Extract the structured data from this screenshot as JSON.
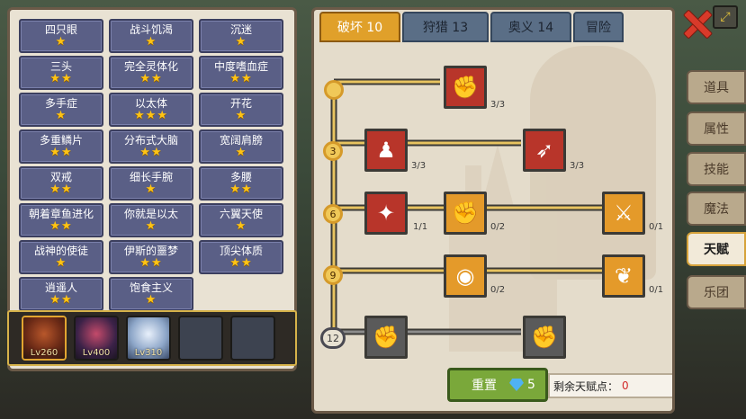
{
  "traits": [
    {
      "name": "四只眼",
      "stars": 1
    },
    {
      "name": "战斗饥渴",
      "stars": 1
    },
    {
      "name": "沉迷",
      "stars": 1
    },
    {
      "name": "三头",
      "stars": 2
    },
    {
      "name": "完全灵体化",
      "stars": 2
    },
    {
      "name": "中度嗜血症",
      "stars": 2
    },
    {
      "name": "多手症",
      "stars": 1
    },
    {
      "name": "以太体",
      "stars": 3
    },
    {
      "name": "开花",
      "stars": 1
    },
    {
      "name": "多重鳞片",
      "stars": 2
    },
    {
      "name": "分布式大脑",
      "stars": 2
    },
    {
      "name": "宽阔肩膀",
      "stars": 1
    },
    {
      "name": "双戒",
      "stars": 2
    },
    {
      "name": "细长手腕",
      "stars": 1
    },
    {
      "name": "多腰",
      "stars": 2
    },
    {
      "name": "朝着章鱼进化",
      "stars": 2
    },
    {
      "name": "你就是以太",
      "stars": 1
    },
    {
      "name": "六翼天使",
      "stars": 1
    },
    {
      "name": "战神的使徒",
      "stars": 1
    },
    {
      "name": "伊斯的噩梦",
      "stars": 2
    },
    {
      "name": "顶尖体质",
      "stars": 2
    },
    {
      "name": "逍遥人",
      "stars": 2
    },
    {
      "name": "饱食主义",
      "stars": 1
    }
  ],
  "heroes": [
    {
      "level": "Lv260",
      "active": true
    },
    {
      "level": "Lv400",
      "active": false
    },
    {
      "level": "Lv310",
      "active": false
    },
    {
      "level": "",
      "active": false
    },
    {
      "level": "",
      "active": false
    }
  ],
  "tabs": [
    "破坏 10",
    "狩猎 13",
    "奥义 14",
    "冒险"
  ],
  "tiers": [
    "3",
    "6",
    "9",
    "12"
  ],
  "nodes": [
    {
      "icon": "arm-wrestle-icon",
      "glyph": "✊",
      "color": "red",
      "count": "3/3"
    },
    {
      "icon": "muscle-body-icon",
      "glyph": "♟",
      "color": "red",
      "count": "3/3"
    },
    {
      "icon": "slash-arrow-icon",
      "glyph": "➶",
      "color": "red",
      "count": "3/3"
    },
    {
      "icon": "shield-burst-icon",
      "glyph": "✦",
      "color": "red",
      "count": "1/1"
    },
    {
      "icon": "punch-icon",
      "glyph": "✊",
      "color": "orange",
      "count": "0/2"
    },
    {
      "icon": "sword-splash-icon",
      "glyph": "⚔",
      "color": "orange",
      "count": "0/1"
    },
    {
      "icon": "ring-drop-icon",
      "glyph": "◉",
      "color": "orange",
      "count": "0/2"
    },
    {
      "icon": "demon-wings-icon",
      "glyph": "❦",
      "color": "orange",
      "count": "0/1"
    },
    {
      "icon": "fist-icon",
      "glyph": "✊",
      "color": "grey",
      "count": ""
    },
    {
      "icon": "fist-down-icon",
      "glyph": "✊",
      "color": "grey",
      "count": ""
    }
  ],
  "reset": {
    "label": "重置",
    "cost": "5"
  },
  "points": {
    "label": "剩余天赋点：",
    "value": "0"
  },
  "side_tabs": [
    "道具",
    "属性",
    "技能",
    "魔法",
    "天赋",
    "乐团"
  ],
  "active_side_tab": "天赋"
}
